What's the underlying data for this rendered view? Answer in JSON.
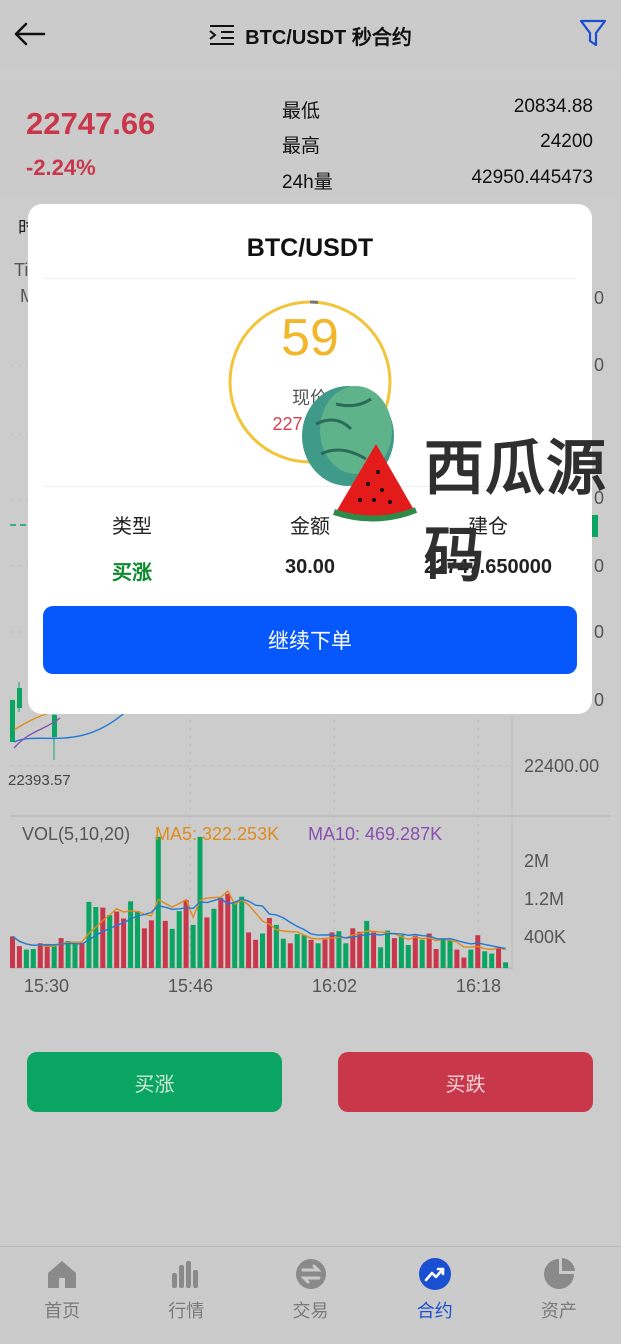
{
  "header": {
    "title": "BTC/USDT 秒合约"
  },
  "ticker": {
    "price": "22747.66",
    "change": "-2.24%",
    "stats": [
      {
        "label": "最低",
        "value": "20834.88"
      },
      {
        "label": "最高",
        "value": "24200"
      },
      {
        "label": "24h量",
        "value": "42950.445473"
      }
    ]
  },
  "chart": {
    "edge_left_1": "时",
    "edge_left_2": "Ti",
    "edge_left_3": "M",
    "min_price_marker": "22393.57",
    "price_axis_partial": [
      "0",
      "0",
      "0",
      "0",
      "0",
      "0"
    ],
    "price_axis_bottom": "22400.00",
    "vol_header": "VOL(5,10,20)",
    "ma5": "MA5: 322.253K",
    "ma10": "MA10: 469.287K",
    "vol_axis": [
      "2M",
      "1.2M",
      "400K"
    ],
    "time_axis": [
      "15:30",
      "15:46",
      "16:02",
      "16:18"
    ]
  },
  "chart_data": {
    "type": "bar",
    "title": "",
    "xlabel": "",
    "ylabel": "",
    "categories": [
      "15:30",
      "15:46",
      "16:02",
      "16:18"
    ],
    "series": [
      {
        "name": "VOL",
        "values": [
          550000,
          380000,
          320000,
          330000,
          430000,
          420000,
          400000,
          520000,
          470000,
          430000,
          440000,
          1150000,
          1060000,
          1050000,
          920000,
          980000,
          860000,
          1160000,
          990000,
          690000,
          830000,
          2280000,
          820000,
          680000,
          990000,
          1180000,
          750000,
          2280000,
          880000,
          1030000,
          1220000,
          1290000,
          1130000,
          1240000,
          620000,
          490000,
          600000,
          870000,
          750000,
          510000,
          430000,
          590000,
          570000,
          490000,
          430000,
          500000,
          620000,
          640000,
          430000,
          690000,
          630000,
          820000,
          620000,
          360000,
          650000,
          520000,
          570000,
          400000,
          560000,
          490000,
          600000,
          330000,
          520000,
          480000,
          320000,
          180000,
          320000,
          570000,
          290000,
          250000,
          360000,
          100000
        ]
      }
    ],
    "ylim": [
      0,
      2400000
    ]
  },
  "actions": {
    "buy_up": "买涨",
    "buy_down": "买跌"
  },
  "modal": {
    "title": "BTC/USDT",
    "countdown": "59",
    "now_label": "现价",
    "now_value": "22747.66",
    "col_type": "类型",
    "col_amount": "金额",
    "col_open": "建仓",
    "val_type": "买涨",
    "val_amount": "30.00",
    "val_open": "22747.650000",
    "continue": "继续下单"
  },
  "watermark": {
    "text": "西瓜源码"
  },
  "tabs": [
    {
      "label": "首页",
      "icon": "home-icon"
    },
    {
      "label": "行情",
      "icon": "bars-icon"
    },
    {
      "label": "交易",
      "icon": "exchange-icon"
    },
    {
      "label": "合约",
      "icon": "trend-icon"
    },
    {
      "label": "资产",
      "icon": "pie-icon"
    }
  ],
  "colors": {
    "up": "#0aa562",
    "down": "#c8384a",
    "accent": "#0657fc",
    "countdown": "#f2b62a"
  }
}
